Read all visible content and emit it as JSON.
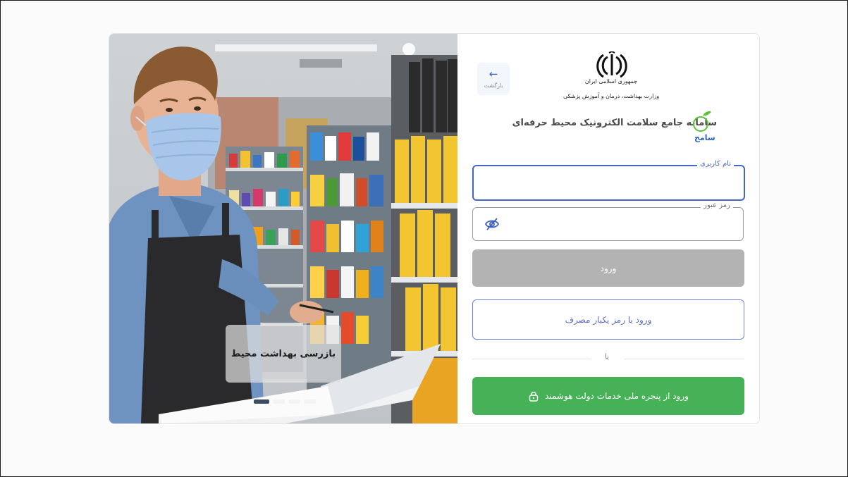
{
  "login": {
    "back_label": "بازگشت",
    "gov_line1": "جمهوری اسلامی ایران",
    "gov_line2": "وزارت بهداشت، درمان و آموزش پزشکی",
    "app_title": "سامانه جامع سلامت الکترونیک محیط حرفه‌ای",
    "logo_text": "سامح",
    "username_label": "نام کاربری",
    "username_value": "",
    "password_label": "رمز عبور",
    "password_value": "",
    "login_button": "ورود",
    "otp_button": "ورود با رمز یکبار مصرف",
    "or_label": "یا",
    "sso_button": "ورود از پنجره ملی خدمات دولت هوشمند"
  },
  "slider": {
    "caption": "بازرسی بهداشت محیط",
    "slide_count": 4,
    "active_slide": 1
  },
  "colors": {
    "primary": "#4565c9",
    "login_disabled": "#b3b3b3",
    "sso_green": "#47b157",
    "logo_green": "#5bbf3a",
    "logo_blue": "#2b64b8"
  }
}
